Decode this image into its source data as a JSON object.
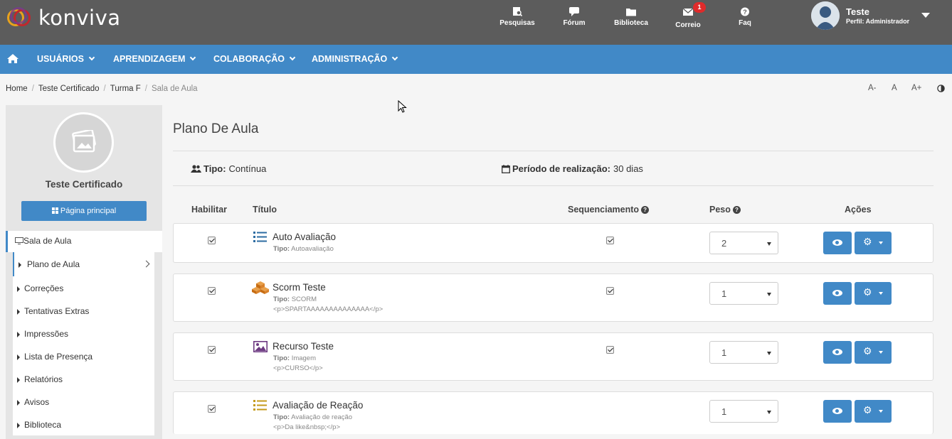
{
  "topbar": {
    "logo_text": "konviva",
    "nav": [
      {
        "label": "Pesquisas",
        "icon": "survey-icon"
      },
      {
        "label": "Fórum",
        "icon": "forum-icon"
      },
      {
        "label": "Biblioteca",
        "icon": "folder-icon"
      },
      {
        "label": "Correio",
        "icon": "mail-icon",
        "badge": "1"
      },
      {
        "label": "Faq",
        "icon": "question-icon"
      }
    ],
    "user": {
      "name": "Teste",
      "role": "Perfil: Administrador"
    }
  },
  "menu": {
    "home_icon": "home-icon",
    "items": [
      "USUÁRIOS",
      "APRENDIZAGEM",
      "COLABORAÇÃO",
      "ADMINISTRAÇÃO"
    ]
  },
  "breadcrumb": [
    "Home",
    "Teste Certificado",
    "Turma F",
    "Sala de Aula"
  ],
  "font_controls": [
    "A-",
    "A",
    "A+"
  ],
  "sidebar": {
    "course_title": "Teste Certificado",
    "main_button": "Página principal",
    "section": "Sala de Aula",
    "items": [
      "Plano de Aula",
      "Correções",
      "Tentativas Extras",
      "Impressões",
      "Lista de Presença",
      "Relatórios",
      "Avisos",
      "Biblioteca"
    ]
  },
  "main": {
    "title": "Plano De Aula",
    "tipo_label": "Tipo:",
    "tipo_value": "Contínua",
    "periodo_label": "Período de realização:",
    "periodo_value": "30 dias",
    "columns": {
      "habilitar": "Habilitar",
      "titulo": "Título",
      "sequenciamento": "Sequenciamento",
      "peso": "Peso",
      "acoes": "Ações"
    },
    "rows": [
      {
        "title": "Auto Avaliação",
        "type_label": "Tipo:",
        "type": "Autoavaliação",
        "desc": "",
        "habilitar": true,
        "sequenciamento": true,
        "peso": "2",
        "icon": "list-icon"
      },
      {
        "title": "Scorm Teste",
        "type_label": "Tipo:",
        "type": "SCORM",
        "desc": "<p>SPARTAAAAAAAAAAAAAA</p>",
        "habilitar": true,
        "sequenciamento": true,
        "peso": "1",
        "icon": "cubes-icon"
      },
      {
        "title": "Recurso Teste",
        "type_label": "Tipo:",
        "type": "Imagem",
        "desc": "<p>CURSO</p>",
        "habilitar": true,
        "sequenciamento": true,
        "peso": "1",
        "icon": "image-icon"
      },
      {
        "title": "Avaliação de Reação",
        "type_label": "Tipo:",
        "type": "Avaliação de reação",
        "desc": "<p>Da like&nbsp;</p>",
        "habilitar": true,
        "sequenciamento": false,
        "peso": "1",
        "icon": "list-icon"
      }
    ]
  },
  "colors": {
    "topbar": "#5c5c5c",
    "primary": "#4189c7",
    "badge": "#e02b2b"
  }
}
